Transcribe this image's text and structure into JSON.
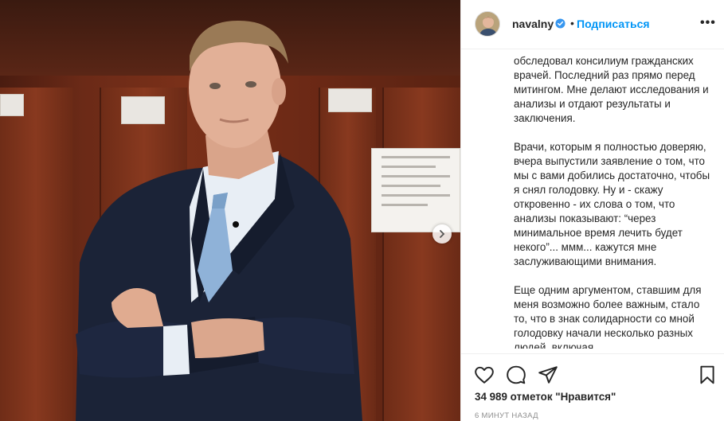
{
  "post": {
    "username": "navalny",
    "dot": "•",
    "follow_label": "Подписаться",
    "more_label": "•••",
    "caption_paragraphs": [
      "обследовал консилиум гражданских врачей. Последний раз прямо перед митингом. Мне делают исследования и анализы и отдают результаты и заключения.",
      "Врачи, которым я полностью доверяю, вчера выпустили заявление о том, что мы с вами добились достаточно, чтобы я снял голодовку. Ну и - скажу откровенно - их слова о том, что анализы показывают: “через минимальное время лечить будет некого”... ммм... кажутся мне заслуживающими внимания.",
      "Еще одним аргументом, ставшим для меня возможно более важным, стало то, что в знак солидарности со мной голодовку начали несколько разных людей, включая"
    ],
    "likes_text": "34 989 отметок \"Нравится\"",
    "time_text": "6 МИНУТ НАЗАД"
  },
  "icons": {
    "verified": "verified-badge-icon",
    "like": "heart-icon",
    "comment": "comment-icon",
    "share": "paper-plane-icon",
    "save": "bookmark-icon",
    "carousel_next": "chevron-right-icon"
  },
  "colors": {
    "link_blue": "#0095f6",
    "text": "#262626",
    "muted": "#8e8e8e",
    "border": "#efefef"
  }
}
